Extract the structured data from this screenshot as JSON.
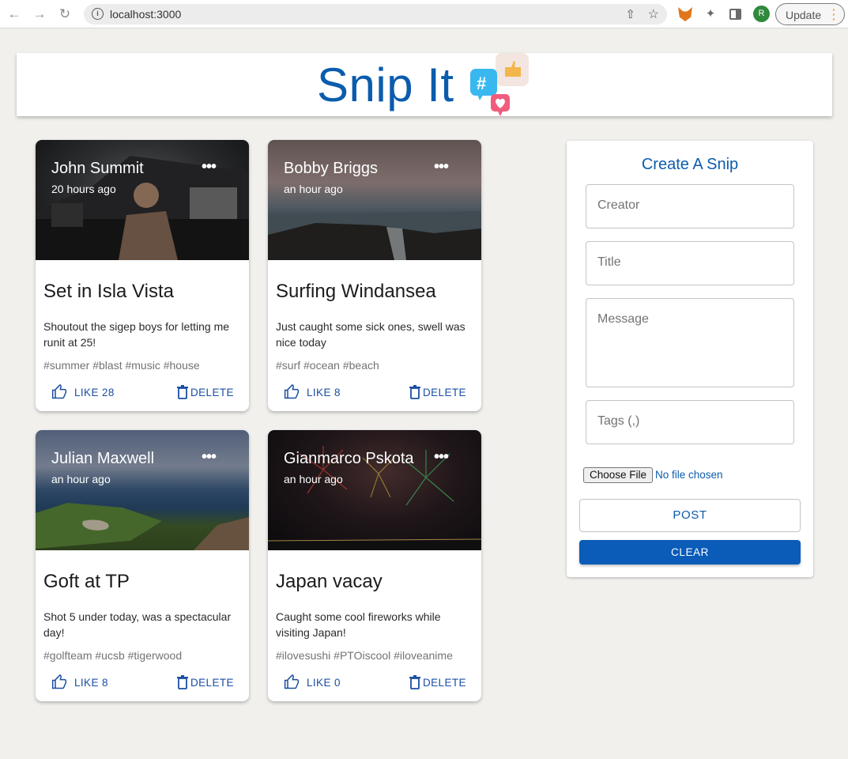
{
  "browser": {
    "url": "localhost:3000",
    "update_label": "Update",
    "profile_initial": "R"
  },
  "header": {
    "title": "Snip It",
    "title_color": "#0b5cad"
  },
  "posts": [
    {
      "creator": "John Summit",
      "time": "20 hours ago",
      "title": "Set in Isla Vista",
      "message": "Shoutout the sigep boys for letting me runit at 25!",
      "tags": "#summer #blast #music #house",
      "like_label": "LIKE 28",
      "delete_label": "DELETE"
    },
    {
      "creator": "Bobby Briggs",
      "time": "an hour ago",
      "title": "Surfing Windansea",
      "message": "Just caught some sick ones, swell was nice today",
      "tags": "#surf #ocean #beach",
      "like_label": "LIKE 8",
      "delete_label": "DELETE"
    },
    {
      "creator": "Julian Maxwell",
      "time": "an hour ago",
      "title": "Goft at TP",
      "message": "Shot 5 under today, was a spectacular day!",
      "tags": "#golfteam #ucsb #tigerwood",
      "like_label": "LIKE 8",
      "delete_label": "DELETE"
    },
    {
      "creator": "Gianmarco Pskota",
      "time": "an hour ago",
      "title": "Japan vacay",
      "message": "Caught some cool fireworks while visiting Japan!",
      "tags": "#ilovesushi #PTOiscool #iloveanime",
      "like_label": "LIKE 0",
      "delete_label": "DELETE"
    }
  ],
  "form": {
    "title": "Create A Snip",
    "creator_placeholder": "Creator",
    "title_placeholder": "Title",
    "message_placeholder": "Message",
    "tags_placeholder": "Tags (,)",
    "choose_file_label": "Choose File",
    "no_file_label": "No file chosen",
    "post_label": "POST",
    "clear_label": "CLEAR"
  },
  "colors": {
    "accent": "#0b5cad",
    "button_text": "#1a4fa3",
    "background": "#f1f0ed"
  }
}
